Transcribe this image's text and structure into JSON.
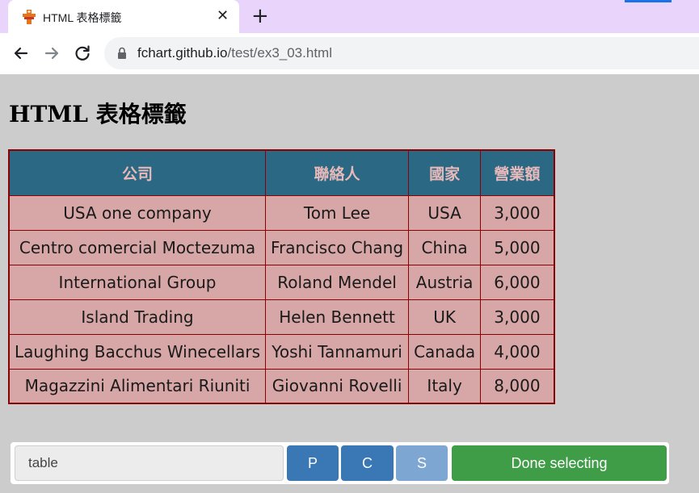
{
  "browser": {
    "tab_title": "HTML 表格標籤",
    "tab_close": "✕",
    "new_tab": "+",
    "url_host": "fchart.github.io",
    "url_path": "/test/ex3_03.html"
  },
  "page": {
    "title": "HTML 表格標籤"
  },
  "table": {
    "headers": [
      "公司",
      "聯絡人",
      "國家",
      "營業額"
    ],
    "rows": [
      [
        "USA one company",
        "Tom Lee",
        "USA",
        "3,000"
      ],
      [
        "Centro comercial Moctezuma",
        "Francisco Chang",
        "China",
        "5,000"
      ],
      [
        "International Group",
        "Roland Mendel",
        "Austria",
        "6,000"
      ],
      [
        "Island Trading",
        "Helen Bennett",
        "UK",
        "3,000"
      ],
      [
        "Laughing Bacchus Winecellars",
        "Yoshi Tannamuri",
        "Canada",
        "4,000"
      ],
      [
        "Magazzini Alimentari Riuniti",
        "Giovanni Rovelli",
        "Italy",
        "8,000"
      ]
    ]
  },
  "selector": {
    "input_value": "table",
    "btn_p": "P",
    "btn_c": "C",
    "btn_s": "S",
    "btn_done": "Done selecting"
  },
  "colors": {
    "header_bg": "#2b6884",
    "header_text": "#e8b9b9",
    "cell_bg": "#d7a6a6",
    "border": "#8b0000",
    "done_btn": "#3f9c47",
    "primary_btn": "#3a78b5"
  },
  "icons": {
    "favicon": "fchart-favicon-icon",
    "back": "arrow-left-icon",
    "forward": "arrow-right-icon",
    "reload": "reload-icon",
    "lock": "lock-icon"
  }
}
